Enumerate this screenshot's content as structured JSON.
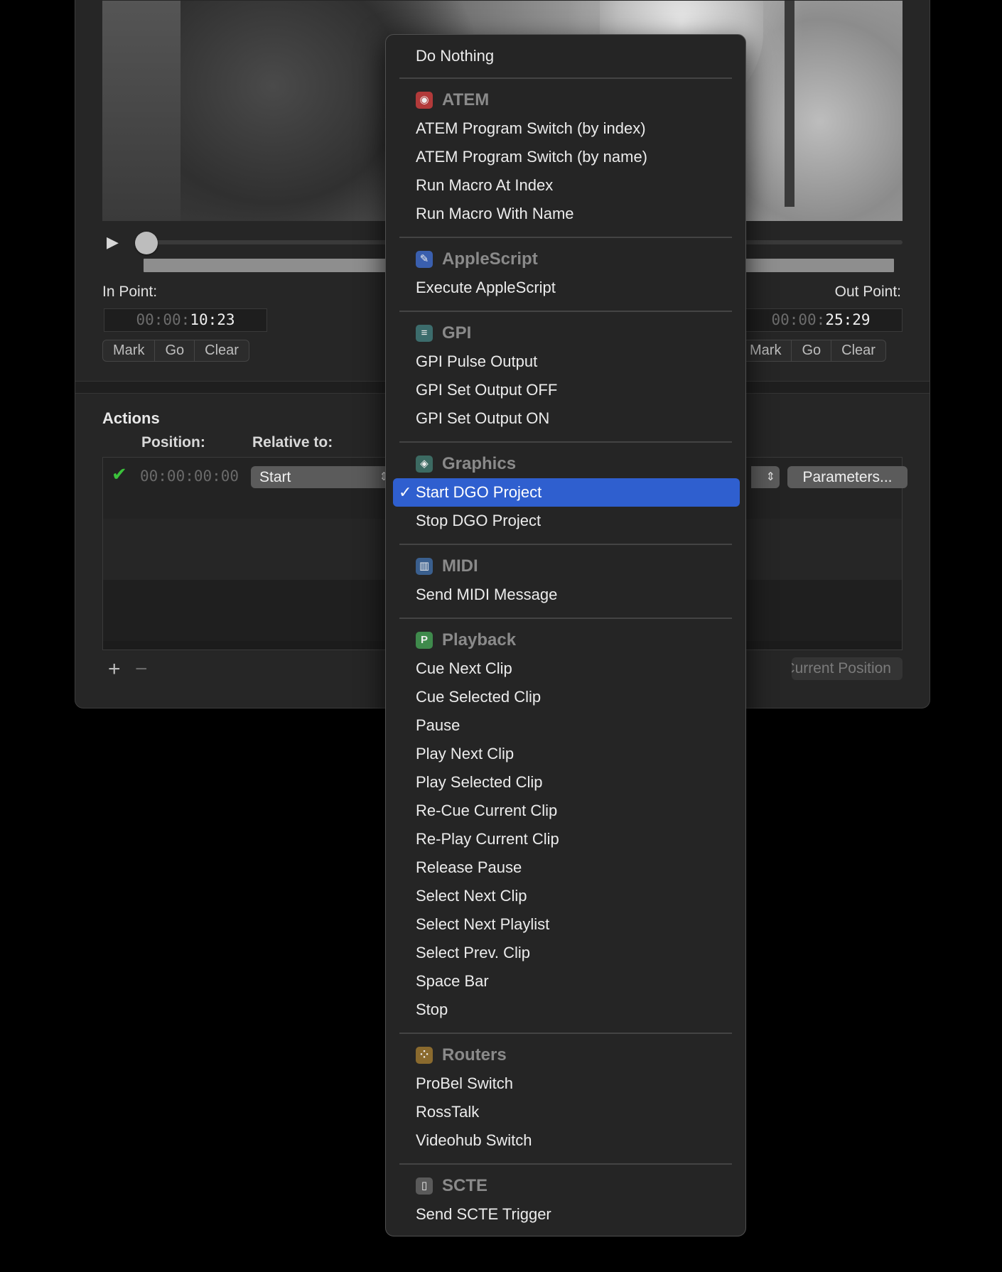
{
  "window": {
    "in_point_label": "In Point:",
    "out_point_label": "Out Point:",
    "in_tc_dim": "00:00:",
    "in_tc_value": "10:23",
    "out_tc_dim": "00:00:",
    "out_tc_value": "25:29",
    "in_buttons": [
      "Mark",
      "Go",
      "Clear"
    ],
    "out_buttons": [
      "Mark",
      "Go",
      "Clear"
    ],
    "actions_title": "Actions",
    "col_position": "Position:",
    "col_relative": "Relative to:",
    "row1_position": "00:00:00:00",
    "row1_relative": "Start",
    "parameters_button": "Parameters...",
    "set_position_button": "To Current Position",
    "add_symbol": "+",
    "remove_symbol": "−"
  },
  "menu": {
    "do_nothing": "Do Nothing",
    "atem": {
      "header": "ATEM",
      "items": [
        "ATEM Program Switch (by index)",
        "ATEM Program Switch (by name)",
        "Run Macro At Index",
        "Run Macro With Name"
      ]
    },
    "applescript": {
      "header": "AppleScript",
      "items": [
        "Execute AppleScript"
      ]
    },
    "gpi": {
      "header": "GPI",
      "items": [
        "GPI Pulse Output",
        "GPI Set Output OFF",
        "GPI Set Output ON"
      ]
    },
    "graphics": {
      "header": "Graphics",
      "selected": "Start DGO Project",
      "items": [
        "Stop DGO Project"
      ]
    },
    "midi": {
      "header": "MIDI",
      "items": [
        "Send MIDI Message"
      ]
    },
    "playback": {
      "header": "Playback",
      "items": [
        "Cue Next Clip",
        "Cue Selected Clip",
        "Pause",
        "Play Next Clip",
        "Play Selected Clip",
        "Re-Cue Current Clip",
        "Re-Play Current Clip",
        "Release Pause",
        "Select Next Clip",
        "Select Next Playlist",
        "Select Prev. Clip",
        "Space Bar",
        "Stop"
      ]
    },
    "routers": {
      "header": "Routers",
      "items": [
        "ProBel Switch",
        "RossTalk",
        "Videohub Switch"
      ]
    },
    "scte": {
      "header": "SCTE",
      "items": [
        "Send SCTE Trigger"
      ]
    }
  }
}
